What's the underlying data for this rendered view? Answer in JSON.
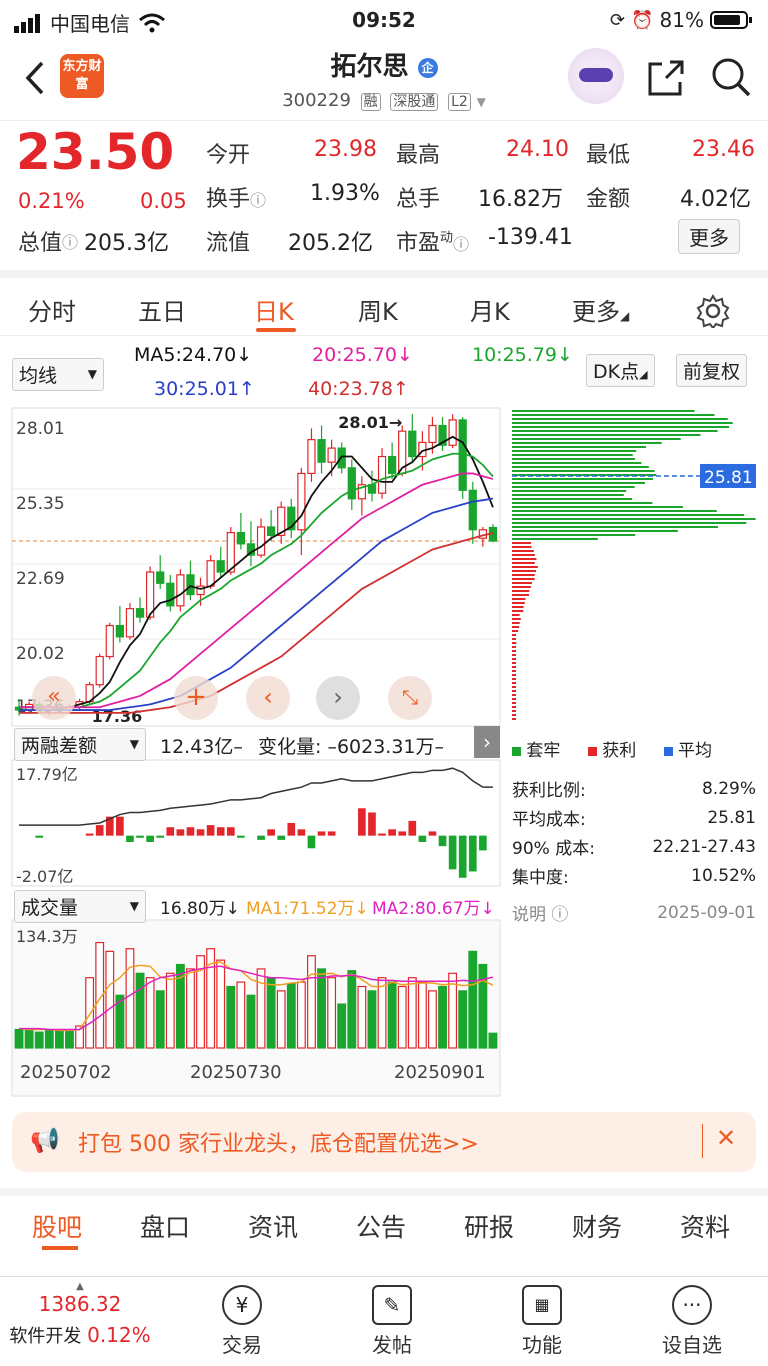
{
  "status": {
    "carrier": "中国电信",
    "time": "09:52",
    "battery": "81%"
  },
  "header": {
    "logo": "东方财富",
    "stock_name": "拓尔思",
    "badge": "企",
    "code": "300229",
    "tags": [
      "融",
      "深股通",
      "L2"
    ]
  },
  "quote": {
    "price": "23.50",
    "change_pct": "0.21%",
    "change": "0.05",
    "total_value_label": "总值",
    "total_value": "205.3亿",
    "open_label": "今开",
    "open": "23.98",
    "high_label": "最高",
    "high": "24.10",
    "low_label": "最低",
    "low": "23.46",
    "turnover_label": "换手",
    "turnover": "1.93%",
    "hands_label": "总手",
    "hands": "16.82万",
    "amount_label": "金额",
    "amount": "4.02亿",
    "float_label": "流值",
    "float_value": "205.2亿",
    "pe_label": "市盈",
    "pe_sup": "动",
    "pe": "-139.41",
    "more": "更多"
  },
  "tabs": [
    "分时",
    "五日",
    "日K",
    "周K",
    "月K",
    "更多"
  ],
  "active_tab": "日K",
  "kline_header": {
    "indicator": "均线",
    "ma5": "MA5:24.70↓",
    "ma20": "20:25.70↓",
    "ma10": "10:25.79↓",
    "ma30": "30:25.01↑",
    "ma40": "40:23.78↑",
    "dk": "DK点",
    "adjust": "前复权"
  },
  "colors": {
    "up": "#e2262a",
    "down": "#1aa62e",
    "accent": "#ee5a24",
    "ma5": "#111111",
    "ma10": "#1aa62e",
    "ma20": "#e020a0",
    "ma30": "#2a40c8",
    "ma40": "#d03030"
  },
  "chart_data": [
    {
      "type": "candlestick",
      "title": "日K",
      "y_ticks": [
        "28.01",
        "25.35",
        "22.69",
        "20.02",
        "17.36"
      ],
      "ylim": [
        17.36,
        28.01
      ],
      "annotations": {
        "max_label": "28.01→",
        "min_label": "17.36",
        "dashed_price": 23.5
      },
      "ohlc": [
        [
          17.6,
          17.9,
          17.3,
          17.5
        ],
        [
          17.5,
          17.8,
          17.4,
          17.7
        ],
        [
          17.7,
          17.8,
          17.4,
          17.5
        ],
        [
          17.5,
          17.7,
          17.3,
          17.6
        ],
        [
          17.6,
          17.8,
          17.4,
          17.5
        ],
        [
          17.5,
          17.7,
          17.36,
          17.6
        ],
        [
          17.6,
          17.9,
          17.5,
          17.8
        ],
        [
          17.8,
          18.5,
          17.7,
          18.4
        ],
        [
          18.4,
          19.5,
          18.3,
          19.4
        ],
        [
          19.4,
          20.6,
          19.3,
          20.5
        ],
        [
          20.5,
          21.2,
          19.9,
          20.1
        ],
        [
          20.1,
          21.3,
          20.0,
          21.1
        ],
        [
          21.1,
          21.5,
          20.6,
          20.8
        ],
        [
          20.8,
          22.6,
          20.7,
          22.4
        ],
        [
          22.4,
          23.0,
          21.8,
          22.0
        ],
        [
          22.0,
          22.3,
          21.0,
          21.2
        ],
        [
          21.2,
          22.5,
          21.0,
          22.3
        ],
        [
          22.3,
          22.8,
          21.4,
          21.6
        ],
        [
          21.6,
          22.2,
          21.2,
          21.9
        ],
        [
          21.9,
          23.0,
          21.8,
          22.8
        ],
        [
          22.8,
          23.3,
          22.2,
          22.4
        ],
        [
          22.4,
          24.0,
          22.3,
          23.8
        ],
        [
          23.8,
          24.5,
          23.2,
          23.4
        ],
        [
          23.4,
          24.2,
          22.6,
          23.0
        ],
        [
          23.0,
          24.3,
          22.9,
          24.0
        ],
        [
          24.0,
          24.6,
          23.5,
          23.7
        ],
        [
          23.7,
          24.9,
          23.4,
          24.7
        ],
        [
          24.7,
          25.0,
          23.6,
          23.9
        ],
        [
          23.9,
          26.1,
          23.0,
          25.9
        ],
        [
          25.9,
          27.5,
          25.6,
          27.1
        ],
        [
          27.1,
          27.6,
          25.9,
          26.3
        ],
        [
          26.3,
          27.1,
          25.8,
          26.8
        ],
        [
          26.8,
          27.0,
          25.9,
          26.1
        ],
        [
          26.1,
          26.4,
          24.6,
          25.0
        ],
        [
          25.0,
          25.8,
          24.4,
          25.5
        ],
        [
          25.5,
          26.0,
          24.9,
          25.2
        ],
        [
          25.2,
          26.8,
          25.0,
          26.5
        ],
        [
          26.5,
          27.0,
          25.7,
          25.9
        ],
        [
          25.9,
          27.6,
          25.8,
          27.4
        ],
        [
          27.4,
          28.01,
          26.3,
          26.5
        ],
        [
          26.5,
          27.4,
          26.0,
          27.0
        ],
        [
          27.0,
          27.9,
          26.6,
          27.6
        ],
        [
          27.6,
          27.9,
          26.7,
          26.9
        ],
        [
          26.9,
          28.0,
          26.8,
          27.8
        ],
        [
          27.8,
          27.9,
          25.0,
          25.3
        ],
        [
          25.3,
          25.6,
          23.4,
          23.9
        ],
        [
          23.6,
          24.0,
          23.3,
          23.9
        ],
        [
          23.98,
          24.1,
          23.46,
          23.5
        ]
      ],
      "ma": {
        "MA5": [
          17.6,
          17.6,
          17.6,
          17.6,
          17.6,
          17.6,
          17.7,
          17.8,
          18.1,
          18.5,
          19.2,
          19.8,
          20.2,
          20.9,
          21.3,
          21.4,
          21.6,
          21.9,
          21.8,
          21.9,
          22.2,
          22.5,
          22.8,
          23.1,
          23.3,
          23.6,
          23.8,
          24.0,
          24.4,
          25.1,
          25.6,
          26.0,
          26.5,
          26.5,
          26.1,
          25.7,
          25.6,
          25.6,
          26.1,
          26.3,
          26.7,
          26.8,
          27.0,
          27.2,
          27.0,
          26.4,
          25.6,
          24.7
        ],
        "MA10": [
          17.6,
          17.6,
          17.6,
          17.6,
          17.6,
          17.6,
          17.6,
          17.7,
          17.8,
          18.0,
          18.3,
          18.6,
          18.9,
          19.4,
          19.9,
          20.3,
          20.8,
          21.1,
          21.4,
          21.6,
          21.8,
          22.1,
          22.3,
          22.5,
          22.7,
          23.0,
          23.2,
          23.4,
          23.7,
          24.1,
          24.5,
          24.8,
          25.1,
          25.3,
          25.4,
          25.5,
          25.7,
          25.8,
          25.9,
          26.0,
          26.2,
          26.4,
          26.5,
          26.6,
          26.6,
          26.5,
          26.2,
          25.79
        ],
        "MA20": [
          17.6,
          17.6,
          17.6,
          17.6,
          17.6,
          17.6,
          17.6,
          17.6,
          17.6,
          17.7,
          17.8,
          17.9,
          18.0,
          18.2,
          18.4,
          18.6,
          18.9,
          19.2,
          19.5,
          19.8,
          20.1,
          20.4,
          20.7,
          21.0,
          21.3,
          21.6,
          21.9,
          22.2,
          22.5,
          22.8,
          23.1,
          23.4,
          23.7,
          24.0,
          24.3,
          24.5,
          24.7,
          24.9,
          25.1,
          25.3,
          25.5,
          25.6,
          25.7,
          25.8,
          25.9,
          25.9,
          25.8,
          25.7
        ],
        "MA30": [
          17.5,
          17.5,
          17.5,
          17.5,
          17.5,
          17.5,
          17.5,
          17.5,
          17.5,
          17.5,
          17.55,
          17.6,
          17.65,
          17.7,
          17.8,
          17.9,
          18.0,
          18.2,
          18.4,
          18.6,
          18.8,
          19.0,
          19.3,
          19.6,
          19.9,
          20.2,
          20.5,
          20.8,
          21.1,
          21.4,
          21.7,
          22.0,
          22.3,
          22.6,
          22.9,
          23.2,
          23.5,
          23.7,
          23.9,
          24.1,
          24.3,
          24.5,
          24.6,
          24.7,
          24.8,
          24.9,
          24.95,
          25.01
        ],
        "MA40": [
          17.4,
          17.4,
          17.4,
          17.4,
          17.4,
          17.4,
          17.4,
          17.4,
          17.4,
          17.4,
          17.4,
          17.4,
          17.45,
          17.5,
          17.55,
          17.6,
          17.7,
          17.8,
          17.9,
          18.0,
          18.2,
          18.4,
          18.6,
          18.8,
          19.0,
          19.2,
          19.4,
          19.7,
          20.0,
          20.3,
          20.6,
          20.9,
          21.2,
          21.5,
          21.8,
          22.0,
          22.2,
          22.4,
          22.6,
          22.8,
          23.0,
          23.2,
          23.3,
          23.4,
          23.5,
          23.6,
          23.7,
          23.78
        ]
      }
    },
    {
      "type": "bar",
      "title": "两融差额",
      "y_ticks": [
        "17.79亿",
        "-2.07亿"
      ],
      "values": [
        0,
        0,
        -0.1,
        0,
        0,
        0,
        0,
        0.1,
        0.5,
        0.9,
        0.9,
        -0.3,
        -0.1,
        -0.3,
        -0.1,
        0.4,
        0.3,
        0.4,
        0.3,
        0.5,
        0.4,
        0.4,
        -0.1,
        0,
        -0.2,
        0.3,
        -0.2,
        0.6,
        0.3,
        -0.6,
        0.2,
        0.2,
        0,
        0,
        1.3,
        1.1,
        0.1,
        0.3,
        0.2,
        0.7,
        -0.3,
        0.2,
        -0.5,
        -1.6,
        -2.0,
        -1.7,
        -0.7,
        0
      ],
      "line": [
        0.5,
        0.5,
        0.5,
        0.5,
        0.5,
        0.5,
        0.5,
        0.55,
        0.6,
        0.8,
        1.0,
        1.1,
        1.1,
        1.15,
        1.2,
        1.3,
        1.35,
        1.4,
        1.45,
        1.5,
        1.6,
        1.7,
        1.7,
        1.75,
        1.8,
        2.0,
        2.1,
        2.2,
        2.3,
        2.5,
        2.5,
        2.6,
        2.7,
        2.6,
        2.6,
        2.6,
        2.7,
        2.8,
        2.9,
        3.0,
        3.0,
        3.1,
        3.1,
        3.2,
        3.0,
        2.6,
        2.3,
        2.3
      ],
      "ylim": [
        -2.07,
        17.79
      ]
    },
    {
      "type": "bar",
      "title": "成交量",
      "y_ticks": [
        "134.3万"
      ],
      "x_ticks": [
        "20250702",
        "20250730",
        "20250901"
      ],
      "values": [
        21,
        20,
        18,
        21,
        19,
        19,
        25,
        80,
        120,
        110,
        60,
        113,
        85,
        80,
        65,
        85,
        95,
        90,
        105,
        113,
        100,
        70,
        75,
        60,
        90,
        80,
        65,
        73,
        75,
        105,
        90,
        80,
        50,
        88,
        70,
        65,
        80,
        75,
        70,
        80,
        75,
        65,
        70,
        85,
        65,
        110,
        95,
        16.8
      ],
      "up": [
        0,
        0,
        0,
        0,
        0,
        0,
        1,
        1,
        1,
        1,
        0,
        1,
        0,
        1,
        0,
        1,
        0,
        1,
        1,
        1,
        1,
        0,
        1,
        0,
        1,
        0,
        1,
        0,
        1,
        1,
        0,
        1,
        0,
        0,
        1,
        0,
        1,
        0,
        1,
        1,
        1,
        1,
        0,
        1,
        0,
        0,
        0,
        0
      ],
      "ma1": [
        22,
        21,
        21,
        21,
        20,
        20,
        21,
        38,
        56,
        72,
        80,
        92,
        94,
        93,
        81,
        78,
        80,
        86,
        88,
        96,
        98,
        90,
        88,
        78,
        74,
        72,
        72,
        74,
        75,
        84,
        84,
        85,
        81,
        84,
        78,
        70,
        70,
        75,
        72,
        73,
        74,
        74,
        72,
        73,
        71,
        72,
        77,
        71.52
      ],
      "ma2": [
        22,
        22,
        22,
        21,
        21,
        21,
        21,
        28,
        36,
        45,
        53,
        60,
        67,
        75,
        80,
        82,
        84,
        88,
        90,
        92,
        93,
        90,
        88,
        85,
        82,
        80,
        80,
        79,
        78,
        80,
        80,
        82,
        82,
        83,
        81,
        78,
        77,
        77,
        76,
        76,
        76,
        76,
        76,
        76,
        77,
        76,
        78,
        80.67
      ],
      "ylim": [
        0,
        134.3
      ]
    },
    {
      "type": "bar",
      "title": "筹码分布",
      "value_label": "25.81",
      "legend": [
        "套牢",
        "获利",
        "平均"
      ]
    }
  ],
  "margin_header": {
    "label": "两融差额",
    "value": "12.43亿–",
    "change": "变化量: –6023.31万–"
  },
  "volume_header": {
    "label": "成交量",
    "vol": "16.80万↓",
    "ma1": "MA1:71.52万↓",
    "ma2": "MA2:80.67万↓"
  },
  "chips": {
    "price_tag": "25.81",
    "legend_trapped": "套牢",
    "legend_profit": "获利",
    "legend_avg": "平均",
    "profit_ratio_label": "获利比例:",
    "profit_ratio": "8.29%",
    "avg_cost_label": "平均成本:",
    "avg_cost": "25.81",
    "cost90_label": "90% 成本:",
    "cost90": "22.21-27.43",
    "concentration_label": "集中度:",
    "concentration": "10.52%",
    "note_label": "说明",
    "date": "2025-09-01"
  },
  "banner": {
    "text": "打包 500 家行业龙头，底仓配置优选>>"
  },
  "bottom_tabs": [
    "股吧",
    "盘口",
    "资讯",
    "公告",
    "研报",
    "财务",
    "资料"
  ],
  "footer": {
    "index_value": "1386.32",
    "index_name": "软件开发",
    "index_change": "0.12%",
    "items": [
      "交易",
      "发帖",
      "功能",
      "设自选"
    ]
  }
}
